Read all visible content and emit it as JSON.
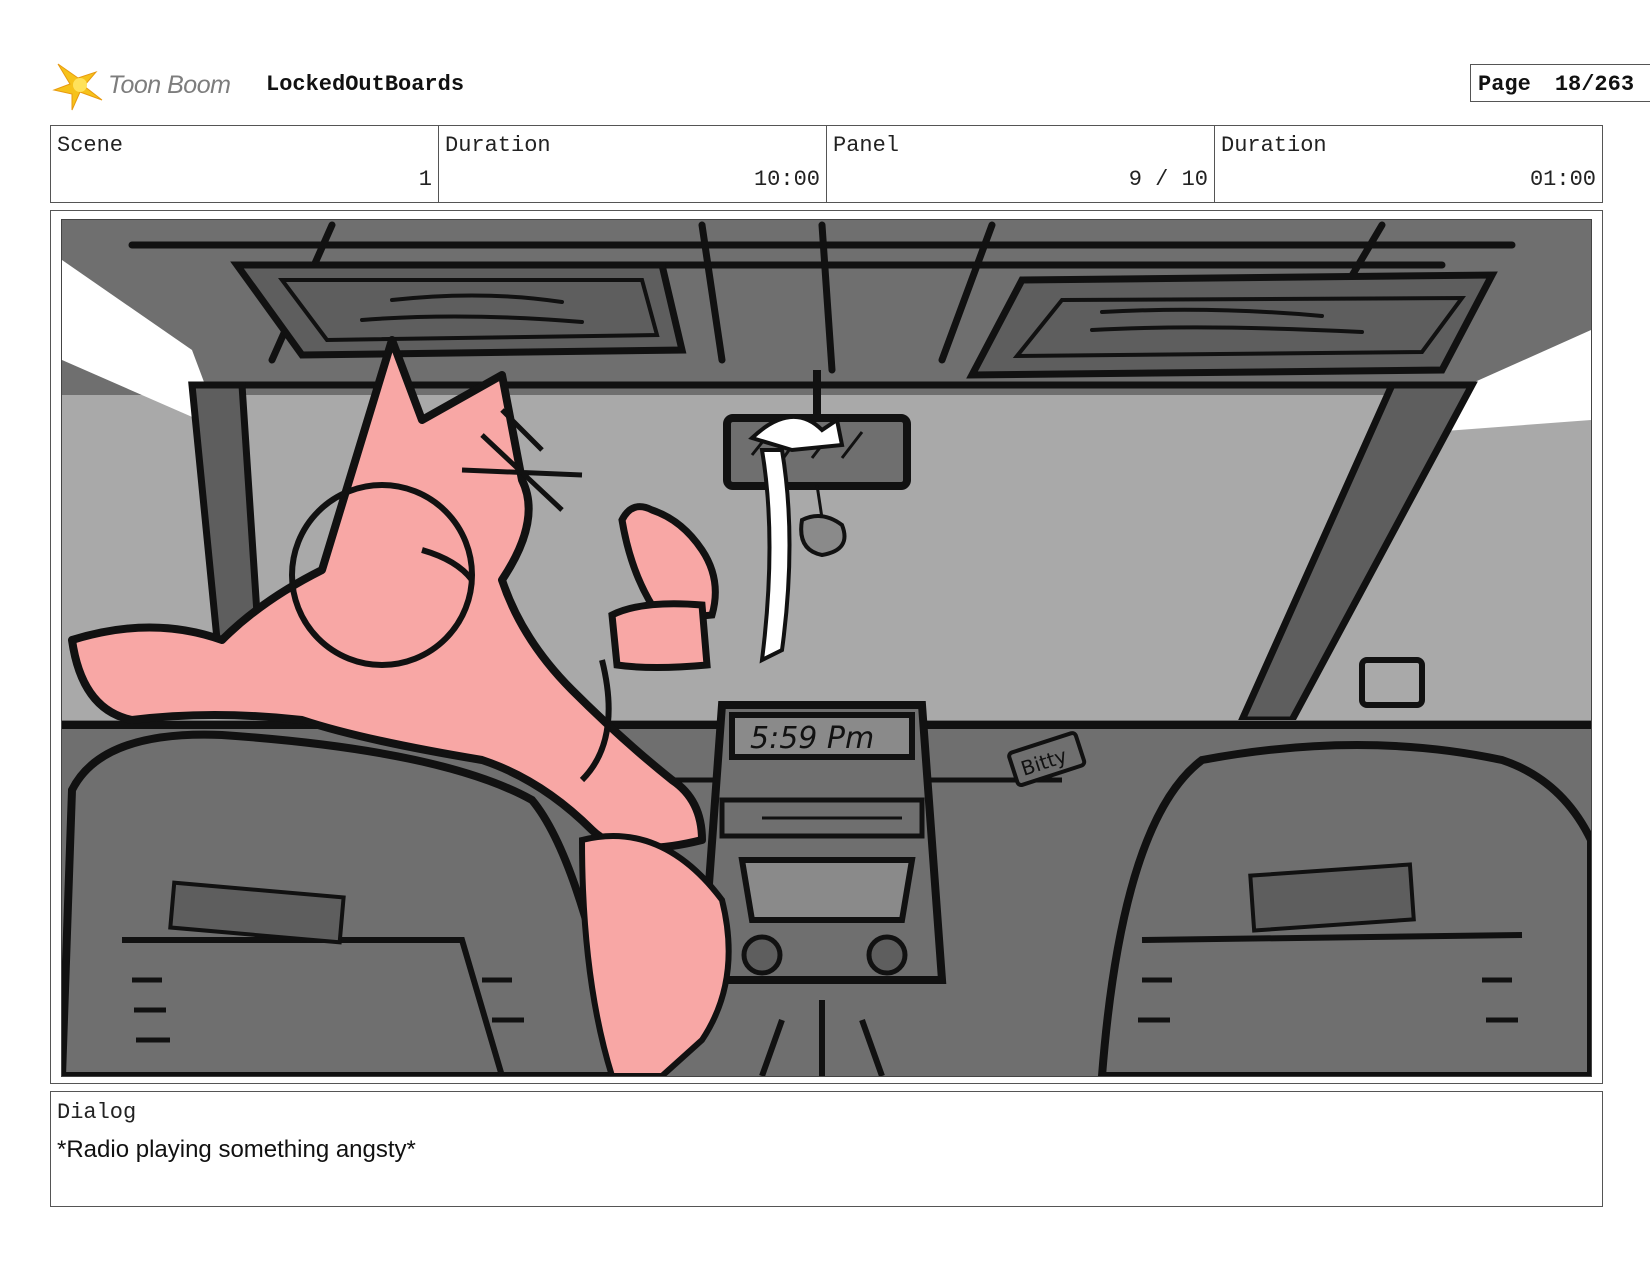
{
  "header": {
    "logo_text": "Toon Boom",
    "project_title": "LockedOutBoards",
    "page_label": "Page",
    "page_value": "18/263"
  },
  "info": {
    "scene_label": "Scene",
    "scene_value": "1",
    "duration_label": "Duration",
    "duration_value": "10:00",
    "panel_label": "Panel",
    "panel_value": "9 / 10",
    "panel_duration_label": "Duration",
    "panel_duration_value": "01:00"
  },
  "panel": {
    "clock_text": "5:59 Pm",
    "badge_text": "Bitty",
    "colors": {
      "character": "#f8a7a5",
      "window": "#a9a9a9",
      "interior": "#6f6f6f",
      "ink": "#111111"
    }
  },
  "dialog": {
    "label": "Dialog",
    "text": "*Radio playing something angsty*"
  }
}
